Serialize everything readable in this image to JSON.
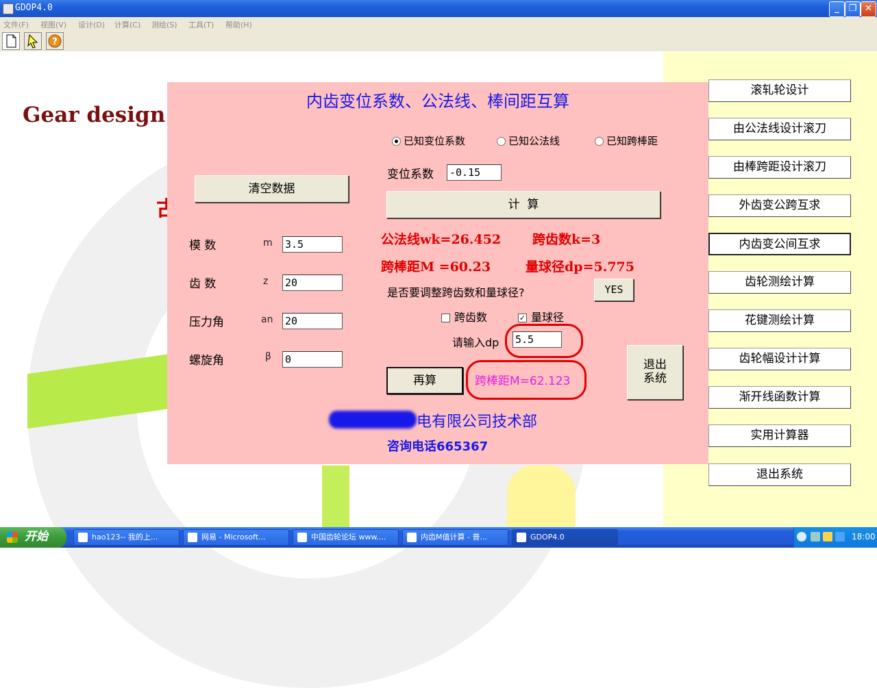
{
  "window": {
    "title": "GDOP4.0"
  },
  "menu": [
    "文件(F)",
    "视图(V)",
    "设计(D)",
    "计算(C)",
    "测绘(S)",
    "工具(T)",
    "帮助(H)"
  ],
  "background": {
    "title": "Gear design c",
    "red_mark": "古"
  },
  "dialog": {
    "title": "内齿变位系数、公法线、棒间距互算",
    "radios": [
      {
        "label": "已知变位系数",
        "selected": true
      },
      {
        "label": "已知公法线",
        "selected": false
      },
      {
        "label": "已知跨棒距",
        "selected": false
      }
    ],
    "shift_coef": {
      "label": "变位系数",
      "value": "-0.15"
    },
    "clear_button": "清空数据",
    "calc_button": "计  算",
    "params": [
      {
        "label": "模 数",
        "symbol": "m",
        "value": "3.5"
      },
      {
        "label": "齿 数",
        "symbol": "z",
        "value": "20"
      },
      {
        "label": "压力角",
        "symbol": "an",
        "value": "20"
      },
      {
        "label": "螺旋角",
        "symbol": "β",
        "value": "0"
      }
    ],
    "results": {
      "wk": "公法线wk=26.452",
      "k": "跨齿数k=3",
      "M": "跨棒距M =60.23",
      "dp": "量球径dp=5.775"
    },
    "adjust_question": "是否要调整跨齿数和量球径?",
    "yes_button": "YES",
    "checks": [
      {
        "label": "跨齿数",
        "checked": false
      },
      {
        "label": "量球径",
        "checked": true
      }
    ],
    "dp_input": {
      "label": "请输入dp",
      "value": "5.5"
    },
    "recalc_button": "再算",
    "recalc_result": "跨棒距M=62.123",
    "exit_button_line1": "退出",
    "exit_button_line2": "系统",
    "company": "电有限公司技术部",
    "phone": "咨询电话665367"
  },
  "side_menu": [
    "滚轧轮设计",
    "由公法线设计滚刀",
    "由棒跨距设计滚刀",
    "外齿变公跨互求",
    "内齿变公间互求",
    "齿轮测绘计算",
    "花键测绘计算",
    "齿轮幅设计计算",
    "渐开线函数计算",
    "实用计算器",
    "退出系统"
  ],
  "taskbar": {
    "start": "开始",
    "tasks": [
      "hao123-- 我的上...",
      "网易 - Microsoft...",
      "中国齿轮论坛 www....",
      "内齿M值计算 - 普...",
      "GDOP4.0"
    ],
    "clock": "18:00"
  },
  "colors": {
    "dialog_bg": "#ffc0c0",
    "title_blue": "#1818e8",
    "result_red": "#e00000",
    "magenta": "#e020e0",
    "right_panel": "#ffffc8"
  }
}
